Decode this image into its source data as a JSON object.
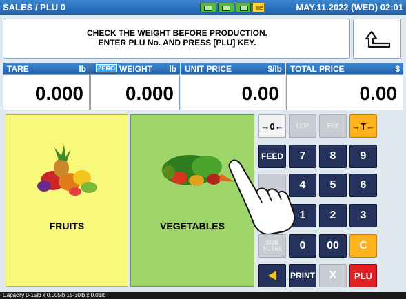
{
  "header": {
    "title": "SALES / PLU 0",
    "datetime": "MAY.11.2022 (WED) 02:01"
  },
  "message": {
    "line1": "CHECK THE WEIGHT BEFORE PRODUCTION.",
    "line2": "ENTER PLU No. AND PRESS [PLU] KEY."
  },
  "fields": {
    "tare": {
      "label": "TARE",
      "unit": "lb",
      "value": "0.000"
    },
    "weight": {
      "label": "WEIGHT",
      "unit": "lb",
      "value": "0.000",
      "zero_badge": "ZERO"
    },
    "unit_price": {
      "label": "UNIT PRICE",
      "unit": "$/lb",
      "value": "0.00"
    },
    "total_price": {
      "label": "TOTAL PRICE",
      "unit": "$",
      "value": "0.00"
    }
  },
  "categories": {
    "fruits": "FRUITS",
    "vegetables": "VEGETABLES"
  },
  "keypad": {
    "zero_key": "→0←",
    "up": "U/P",
    "fix": "FIX",
    "tare_key": "→T←",
    "feed": "FEED",
    "k7": "7",
    "k8": "8",
    "k9": "9",
    "k4": "4",
    "k5": "5",
    "k6": "6",
    "k1": "1",
    "k2": "2",
    "k3": "3",
    "subtotal": "SUB TOTAL",
    "k0": "0",
    "k00": "00",
    "clear": "C",
    "print": "PRINT",
    "x": "X",
    "plu": "PLU"
  },
  "footer": {
    "capacity": "Capacity 0-15lb x 0.005lb  15-30lb x 0.01lb"
  },
  "colors": {
    "topbar": "#2a6fbf",
    "fruits_bg": "#f8f87a",
    "veg_bg": "#9ed66b",
    "key_dark": "#25335c",
    "key_orange": "#ffb21c",
    "key_red": "#e22024"
  }
}
